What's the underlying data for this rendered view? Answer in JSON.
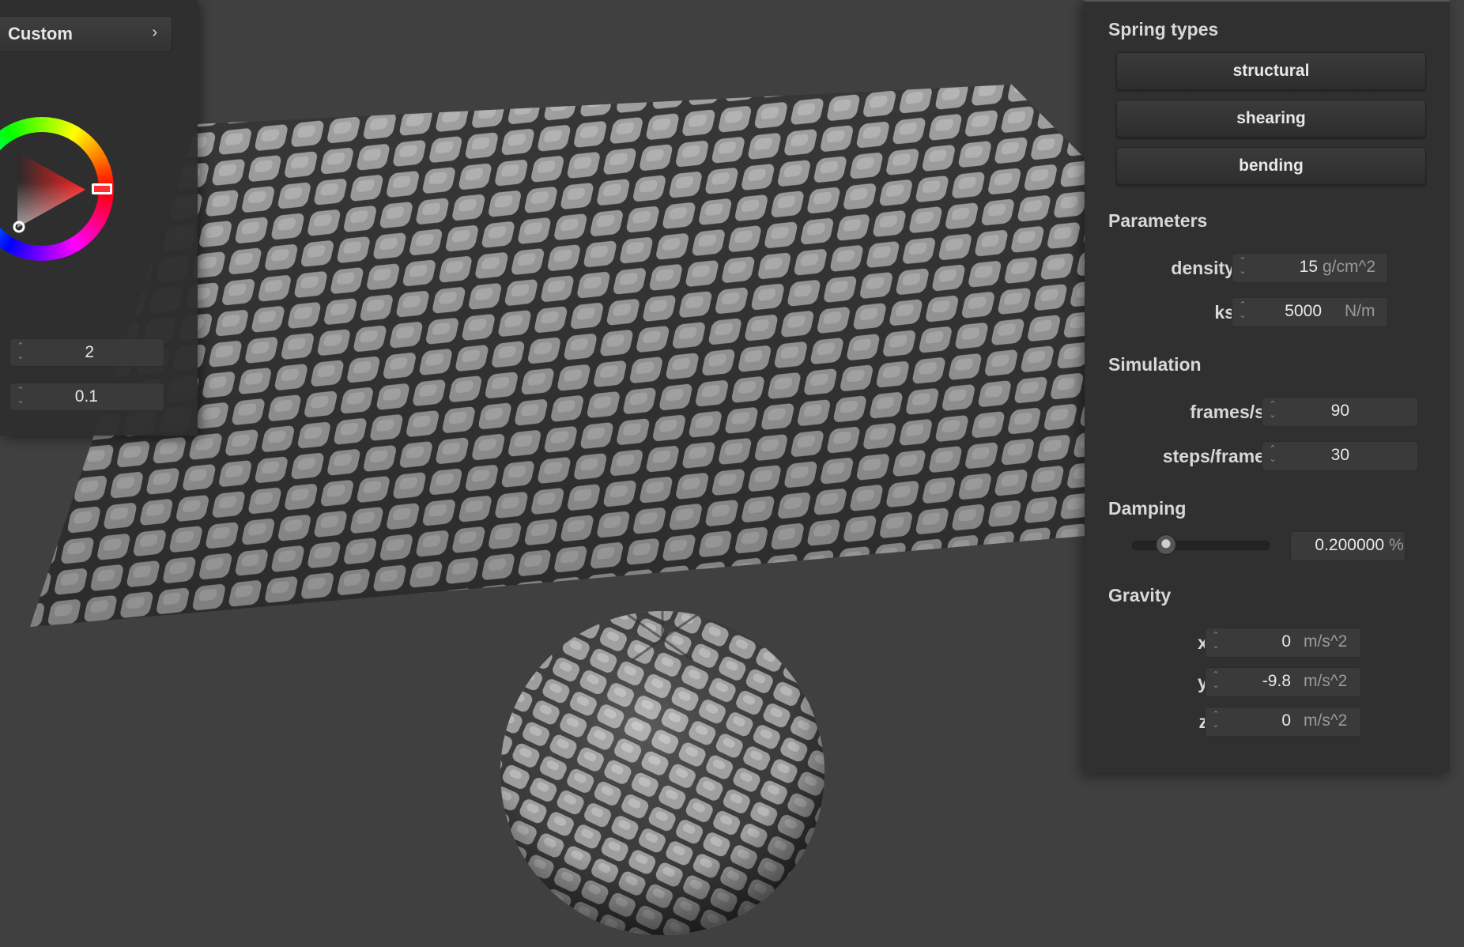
{
  "colors": {
    "background": "#404040",
    "panel": "#303030",
    "accent_red": "#ff3030"
  },
  "left_panel": {
    "preset_button": {
      "label": "Custom",
      "icon": "chevron-right-icon"
    },
    "color_wheel": {
      "selected_hue_color": "#ff0000"
    },
    "spinner_1": {
      "value": "2"
    },
    "spinner_2": {
      "value": "0.1"
    }
  },
  "right_panel": {
    "spring_types": {
      "title": "Spring types",
      "buttons": [
        "structural",
        "shearing",
        "bending"
      ]
    },
    "parameters": {
      "title": "Parameters",
      "density": {
        "label": "density :",
        "value": "15",
        "unit": "g/cm^2"
      },
      "ks": {
        "label": "ks :",
        "value": "5000",
        "unit": "N/m"
      }
    },
    "simulation": {
      "title": "Simulation",
      "fps": {
        "label": "frames/s :",
        "value": "90"
      },
      "steps": {
        "label": "steps/frame :",
        "value": "30"
      }
    },
    "damping": {
      "title": "Damping",
      "slider_level": 0.2,
      "value": "0.200000",
      "unit": "%"
    },
    "gravity": {
      "title": "Gravity",
      "x": {
        "label": "x :",
        "value": "0",
        "unit": "m/s^2"
      },
      "y": {
        "label": "y :",
        "value": "-9.8",
        "unit": "m/s^2"
      },
      "z": {
        "label": "z :",
        "value": "0",
        "unit": "m/s^2"
      }
    }
  },
  "scene": {
    "objects": [
      "cobblestone-cloth",
      "cobblestone-sphere"
    ],
    "texture": "cobblestone"
  }
}
